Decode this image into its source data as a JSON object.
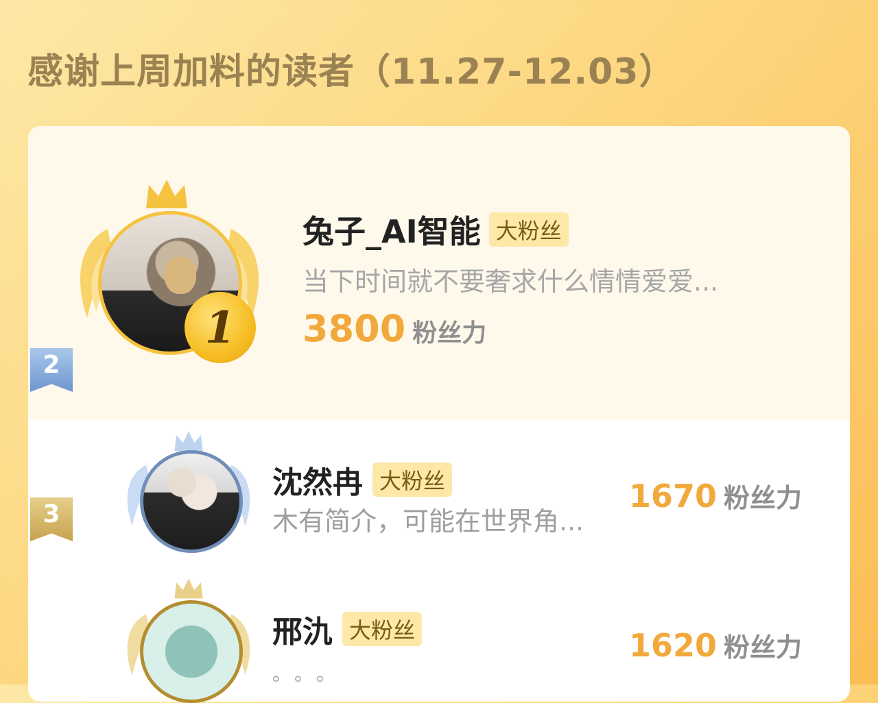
{
  "header": {
    "title": "感谢上周加料的读者（11.27-12.03）"
  },
  "colors": {
    "accent": "#f2a93b",
    "gold": "#f5c340",
    "silver_blue": "#6f8db7",
    "bronze": "#b38d2e",
    "badge_bg": "#fde8a8"
  },
  "readers": [
    {
      "rank": "1",
      "name": "兔子_AI智能",
      "badge": "大粉丝",
      "bio": "当下时间就不要奢求什么情情爱爱...",
      "score": "3800",
      "score_unit": "粉丝力"
    },
    {
      "rank": "2",
      "name": "沈然冉",
      "badge": "大粉丝",
      "bio": "木有简介，可能在世界角...",
      "score": "1670",
      "score_unit": "粉丝力"
    },
    {
      "rank": "3",
      "name": "邢氿",
      "badge": "大粉丝",
      "bio": "。。。",
      "score": "1620",
      "score_unit": "粉丝力"
    }
  ],
  "icons": {
    "crown": "crown-icon",
    "wings": "wings-icon",
    "ribbon": "rank-ribbon-icon"
  }
}
